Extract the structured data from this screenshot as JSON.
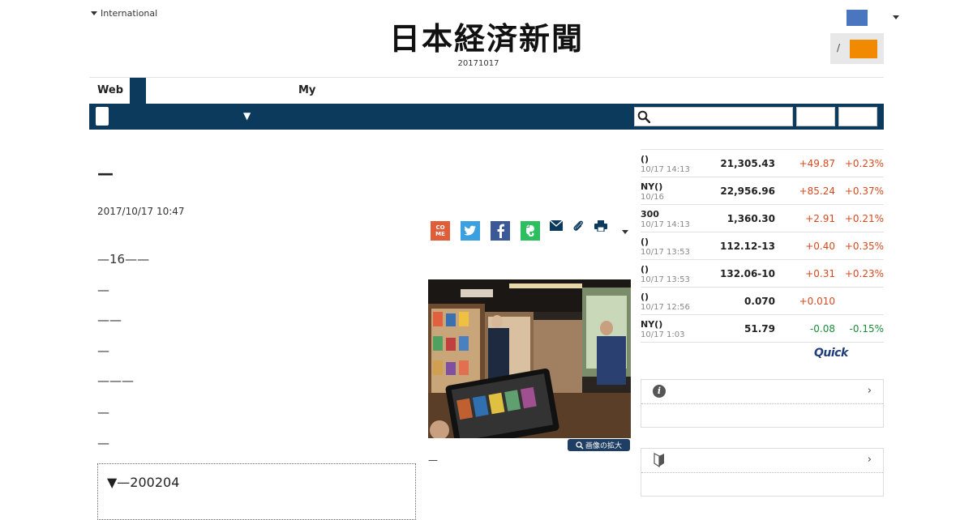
{
  "header": {
    "international_label": "International",
    "logo_text": "日本経済新聞",
    "date": "20171017",
    "login_separator": "/",
    "colors": {
      "nav": "#0c3a5c",
      "accent_orange": "#f28a00",
      "accent_blue": "#4a76c0"
    }
  },
  "nav": {
    "tabs": [
      {
        "label": "Web"
      },
      {
        "label": ""
      },
      {
        "label": "My"
      }
    ],
    "dropdown_arrow": "▼",
    "search": {
      "placeholder": "",
      "icon": "search-icon"
    }
  },
  "article": {
    "title": "—",
    "date": "2017/10/17 10:47",
    "paragraphs": [
      "—16——",
      "—",
      "——",
      "—",
      "———",
      "—",
      "—"
    ],
    "box_heading": "▼—200204",
    "photo_enlarge_label": "画像の拡大",
    "photo_caption": "—",
    "share_icons": [
      "come-icon",
      "twitter-icon",
      "facebook-icon",
      "evernote-icon",
      "mail-icon",
      "clip-icon",
      "print-icon"
    ],
    "come_label": "CO ME"
  },
  "market": {
    "rows": [
      {
        "name": "()",
        "time": "10/17 14:13",
        "value": "21,305.43",
        "change": "+49.87",
        "pct": "+0.23%",
        "dir": "up"
      },
      {
        "name": "NY()",
        "time": "10/16",
        "value": "22,956.96",
        "change": "+85.24",
        "pct": "+0.37%",
        "dir": "up"
      },
      {
        "name": "300",
        "time": "10/17 14:13",
        "value": "1,360.30",
        "change": "+2.91",
        "pct": "+0.21%",
        "dir": "up"
      },
      {
        "name": "()",
        "time": "10/17 13:53",
        "value": "112.12-13",
        "change": "+0.40",
        "pct": "+0.35%",
        "dir": "up"
      },
      {
        "name": "()",
        "time": "10/17 13:53",
        "value": "132.06-10",
        "change": "+0.31",
        "pct": "+0.23%",
        "dir": "up"
      },
      {
        "name": "()",
        "time": "10/17 12:56",
        "value": "0.070",
        "change": "+0.010",
        "pct": "",
        "dir": "up"
      },
      {
        "name": "NY()",
        "time": "10/17 1:03",
        "value": "51.79",
        "change": "-0.08",
        "pct": "-0.15%",
        "dir": "down"
      }
    ],
    "source": "Quick"
  },
  "panels": {
    "chevron": "›"
  }
}
